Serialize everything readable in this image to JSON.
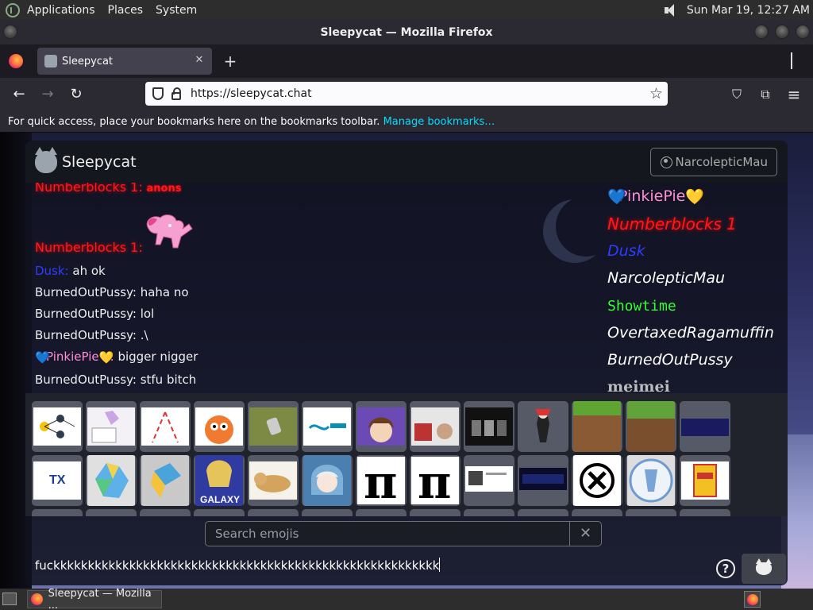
{
  "top_panel": {
    "menus": [
      "Applications",
      "Places",
      "System"
    ],
    "clock": "Sun Mar 19, 12:27 AM"
  },
  "window": {
    "title": "Sleepycat — Mozilla Firefox"
  },
  "tab": {
    "label": "Sleepycat",
    "close": "✕",
    "new_tab": "+"
  },
  "nav": {
    "back": "←",
    "forward": "→",
    "reload": "↻",
    "url": "https://sleepycat.chat",
    "star": "☆",
    "pocket": "⛉",
    "extensions": "⧉",
    "menu": "≡"
  },
  "bookmarks_bar": {
    "text": "For quick access, place your bookmarks here on the bookmarks toolbar.",
    "link": "Manage bookmarks…"
  },
  "site": {
    "title": "Sleepycat",
    "user_button": "NarcolepticMau"
  },
  "messages": [
    {
      "name": "Numberblocks 1:",
      "text": "anons",
      "style": "red-small"
    },
    {
      "name": "Numberblocks 1:",
      "text": "",
      "style": "red-image"
    },
    {
      "name": "Dusk:",
      "text": "ah ok",
      "style": "blue"
    },
    {
      "name": "BurnedOutPussy:",
      "text": "haha no",
      "style": "plain"
    },
    {
      "name": "BurnedOutPussy:",
      "text": "lol",
      "style": "plain"
    },
    {
      "name": "BurnedOutPussy:",
      "text": ".\\",
      "style": "plain"
    },
    {
      "name": "PinkiePie",
      "text": "bigger nigger",
      "style": "pink"
    },
    {
      "name": "BurnedOutPussy:",
      "text": "stfu bitch",
      "style": "plain"
    }
  ],
  "users": [
    {
      "name": "PinkiePie",
      "style": "pink"
    },
    {
      "name": "Numberblocks 1",
      "style": "red"
    },
    {
      "name": "Dusk",
      "style": "blue"
    },
    {
      "name": "NarcolepticMau",
      "style": "white"
    },
    {
      "name": "Showtime",
      "style": "green"
    },
    {
      "name": "OvertaxedRagamuffin",
      "style": "white"
    },
    {
      "name": "BurnedOutPussy",
      "style": "white"
    },
    {
      "name": "meimei",
      "style": "gray"
    }
  ],
  "emoji_search": {
    "placeholder": "Search emojis",
    "clear": "✕"
  },
  "chat_input": {
    "value": "fuckkkkkkkkkkkkkkkkkkkkkkkkkkkkkkkkkkkkkkkkkkkkkkkkkkkkkkkk"
  },
  "help_button": "?",
  "taskbar": {
    "item": "Sleepycat — Mozilla ..."
  },
  "colors": {
    "name_red": "#ff1a1a",
    "name_blue": "#2f3dff",
    "name_pink": "#ff8ed4",
    "name_green": "#33ff33",
    "link": "#00ddff"
  }
}
